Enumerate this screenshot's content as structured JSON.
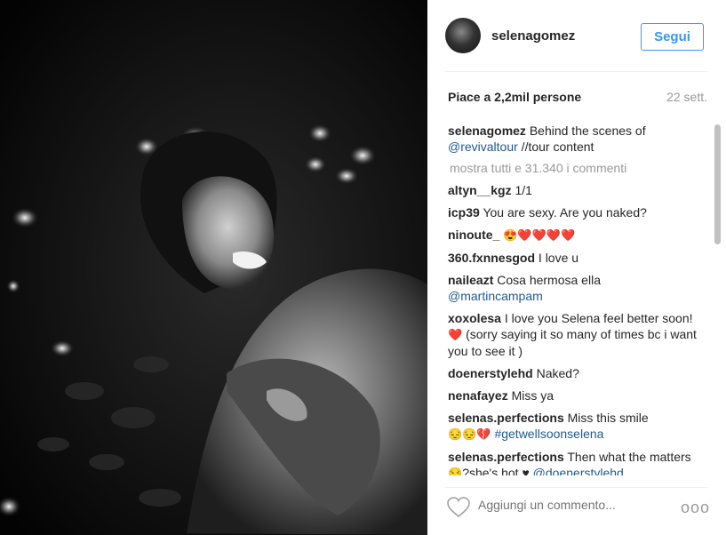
{
  "post": {
    "username": "selenagomez",
    "follow_label": "Segui",
    "likes_text": "Piace a 2,2mil persone",
    "date_text": "22 sett."
  },
  "caption": {
    "user": "selenagomez",
    "text_before": "Behind the scenes of ",
    "mention": "@revivaltour",
    "text_after": " //tour content"
  },
  "show_all_label": "mostra tutti e 31.340 i commenti",
  "comments": [
    {
      "user": "altyn__kgz",
      "text": "1/1"
    },
    {
      "user": "icp39",
      "text": "You are sexy. Are you naked?"
    },
    {
      "user": "ninoute_",
      "emojis": "😍❤️❤️❤️❤️"
    },
    {
      "user": "360.fxnnesgod",
      "text": "I love u"
    },
    {
      "user": "naileazt",
      "text": "Cosa hermosa ella",
      "mention": "@martincampam"
    },
    {
      "user": "xoxolesa",
      "text": "I love you Selena feel better soon! ",
      "emoji": "❤️",
      "text2": " (sorry saying it so many of times bc i want you to see it )"
    },
    {
      "user": "doenerstylehd",
      "text": "Naked?"
    },
    {
      "user": "nenafayez",
      "text": "Miss ya"
    },
    {
      "user": "selenas.perfections",
      "text": "Miss this smile",
      "emojis": "😔😔💔",
      "hashtag": "#getwellsoonselena"
    },
    {
      "user": "selenas.perfections",
      "text": "Then what the matters ",
      "emoji": "😒",
      "text2": "?she's hot ",
      "emoji2": "♥",
      "mention": "@doenerstylehd"
    }
  ],
  "comment_bar": {
    "placeholder": "Aggiungi un commento...",
    "more_label": "ooo"
  },
  "icons": {
    "like": "heart-outline-icon",
    "more": "more-options-icon"
  }
}
